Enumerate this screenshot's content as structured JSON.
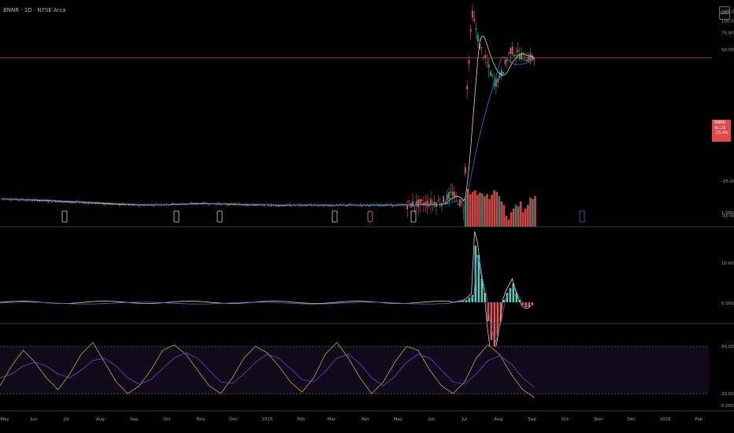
{
  "header": {
    "symbol_title": "BNNR · 1D · NYSE Arca",
    "log_label": "LOG"
  },
  "price_tag": {
    "symbol": "BNNR",
    "last": "41.23",
    "change": "-15.4%"
  },
  "axes": {
    "price_ticks": [
      "125.00",
      "100.00",
      "75.00",
      "50.00",
      "1.000"
    ],
    "volume_ticks": [
      "-25.00",
      "-50.00"
    ],
    "macd_ticks": [
      "10.00",
      "0.000"
    ],
    "stoch_ticks": [
      "80.00",
      "20.00",
      "0.000"
    ],
    "x_ticks": [
      "May",
      "Jun",
      "Jul",
      "Aug",
      "Sep",
      "Oct",
      "Nov",
      "Dec",
      "2025",
      "Feb",
      "Mar",
      "Apr",
      "May",
      "Jun",
      "Jul",
      "Aug",
      "Sep",
      "Oct",
      "Nov",
      "Dec",
      "2026",
      "Feb"
    ]
  },
  "colors": {
    "up": "#26a69a",
    "down": "#ef5350",
    "ma_fast": "#e6d4a6",
    "ma_slow": "#3f6ed8",
    "last_price_line": "#e04a4a",
    "stoch_k": "#b8a44a",
    "stoch_d": "#3a5fcf",
    "event_marker": "#d0d0d0"
  },
  "chart_data": [
    {
      "type": "line",
      "title": "",
      "scale": "log",
      "x_range": [
        "2024-05-01",
        "2026-02-10"
      ],
      "ylim": [
        1,
        150
      ],
      "last_price": 41.23,
      "series": [
        {
          "x": [
            "2024-05-01",
            "2024-07-01",
            "2024-09-01",
            "2024-11-01",
            "2025-01-01",
            "2025-03-01",
            "2025-05-01",
            "2025-06-10",
            "2025-06-20",
            "2025-07-01",
            "2025-07-03",
            "2025-07-08",
            "2025-07-15",
            "2025-07-22",
            "2025-07-29",
            "2025-08-05",
            "2025-08-12",
            "2025-08-19",
            "2025-08-26",
            "2025-09-02"
          ],
          "values": [
            1.4,
            1.3,
            1.2,
            1.25,
            1.2,
            1.2,
            1.2,
            1.3,
            1.6,
            1.1,
            18,
            125,
            55,
            35,
            22,
            30,
            50,
            45,
            42,
            41.23
          ]
        }
      ]
    },
    {
      "type": "bar",
      "title": "",
      "ylim": [
        -60,
        0
      ],
      "x_range": [
        "2025-07-01",
        "2025-09-05"
      ],
      "values": [
        -40,
        -52,
        -45,
        -48,
        -50,
        -44,
        -47,
        -46,
        -42,
        -45,
        -38,
        -44,
        -50,
        -48,
        -42,
        -35,
        -30,
        -15,
        -10,
        -20,
        -25,
        -30,
        -28,
        -35,
        -20,
        -25,
        -30,
        -40,
        -38,
        -42
      ]
    },
    {
      "type": "bar",
      "title": "",
      "series": [
        {
          "values": [
            0,
            0.1,
            0.2,
            0.3,
            0.5,
            1.0,
            1.5,
            12,
            10,
            5,
            2,
            -4,
            -8,
            -10,
            -7,
            -4,
            0.5,
            2,
            3,
            4,
            2,
            0.5,
            -0.5,
            -1,
            -1,
            -0.5
          ]
        }
      ]
    },
    {
      "type": "line",
      "title": "",
      "ylim": [
        0,
        100
      ],
      "reference_lines": [
        80,
        20
      ],
      "series": [
        {
          "values": [
            30,
            55,
            75,
            60,
            40,
            25,
            45,
            70,
            85,
            60,
            35,
            20,
            30,
            50,
            75,
            82,
            70,
            50,
            30,
            20,
            40,
            65,
            80,
            72,
            55,
            35,
            22,
            40,
            70,
            85,
            65,
            40,
            20,
            35,
            60,
            80,
            75,
            50,
            30,
            20,
            35,
            65,
            82,
            70,
            45,
            25,
            15
          ]
        },
        {
          "values": [
            40,
            45,
            55,
            60,
            55,
            45,
            40,
            50,
            62,
            65,
            55,
            40,
            32,
            38,
            52,
            65,
            72,
            65,
            50,
            35,
            33,
            45,
            60,
            70,
            65,
            52,
            38,
            35,
            48,
            65,
            70,
            58,
            40,
            30,
            42,
            60,
            70,
            65,
            50,
            35,
            32,
            45,
            62,
            68,
            58,
            40,
            28
          ]
        }
      ]
    }
  ]
}
